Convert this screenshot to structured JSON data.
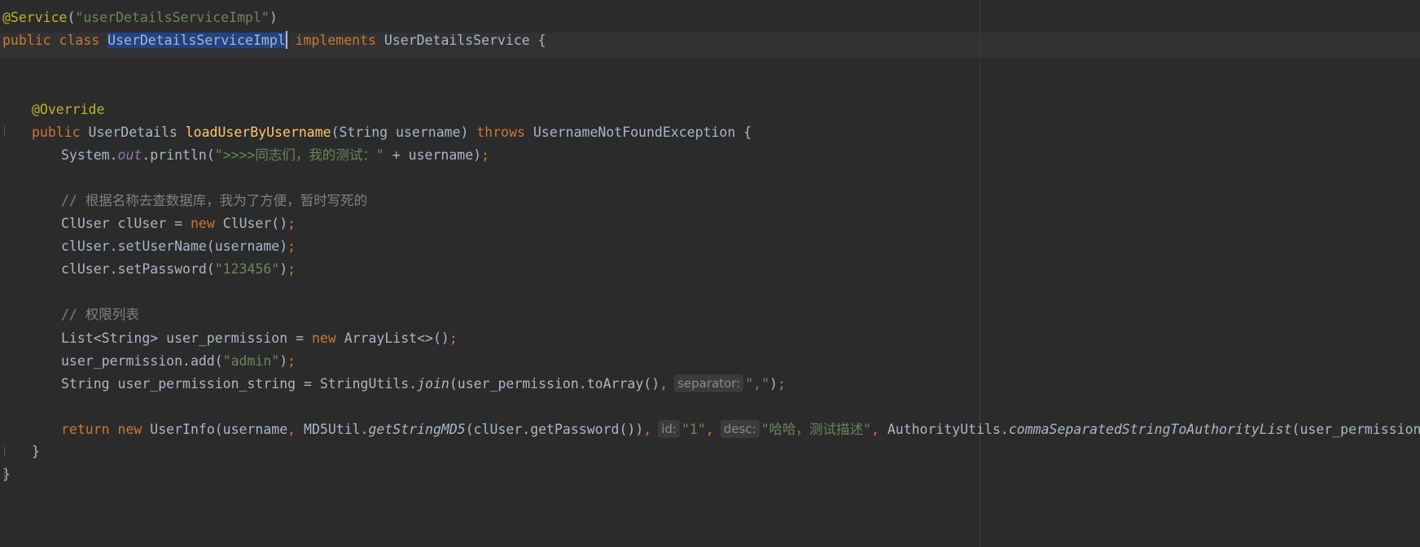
{
  "editor": {
    "lines": {
      "l1": {
        "t1": "@Service",
        "t2": "(",
        "t3": "\"userDetailsServiceImpl\"",
        "t4": ")"
      },
      "l2": {
        "t1": "public class ",
        "t2": "UserDetailsServiceImpl",
        "t3": " ",
        "t4": "implements",
        "t5": " UserDetailsService {"
      },
      "l5": {
        "t1": "@Override"
      },
      "l6": {
        "t1": "public",
        "t2": " UserDetails ",
        "t3": "loadUserByUsername",
        "t4": "(String username) ",
        "t5": "throws",
        "t6": " UsernameNotFoundException {"
      },
      "l7": {
        "t1": "System.",
        "t2": "out",
        "t3": ".println(",
        "t4": "\">>>>同志们，我的测试：\"",
        "t5": " + username)",
        "t6": ";"
      },
      "l9": {
        "t1": "// 根据名称去查数据库，我为了方便，暂时写死的"
      },
      "l10": {
        "t1": "ClUser clUser = ",
        "t2": "new",
        "t3": " ClUser()",
        "t4": ";"
      },
      "l11": {
        "t1": "clUser.setUserName(username)",
        "t2": ";"
      },
      "l12": {
        "t1": "clUser.setPassword(",
        "t2": "\"123456\"",
        "t3": ")",
        "t4": ";"
      },
      "l14": {
        "t1": "// 权限列表"
      },
      "l15": {
        "t1": "List<String> user_permission = ",
        "t2": "new",
        "t3": " ArrayList<>()",
        "t4": ";"
      },
      "l16": {
        "t1": "user_permission.add(",
        "t2": "\"admin\"",
        "t3": ")",
        "t4": ";"
      },
      "l17": {
        "t1": "String user_permission_string = StringUtils.",
        "t2": "join",
        "t3": "(user_permission.toArray()",
        "t4": ",",
        "h1": "separator:",
        "t5": "\",\"",
        "t6": ")",
        "t7": ";"
      },
      "l19": {
        "t1": "return new",
        "t2": " UserInfo(username",
        "t3": ",",
        "t4": " MD5Util.",
        "t5": "getStringMD5",
        "t6": "(clUser.getPassword())",
        "t7": ",",
        "h1": "id:",
        "t8": "\"1\"",
        "t9": ",",
        "h2": "desc:",
        "t10": "\"哈哈，测试描述\"",
        "t11": ",",
        "t12": " AuthorityUtils.",
        "t13": "commaSeparatedStringToAuthorityList",
        "t14": "(user_permission_string)",
        "t15": ");"
      },
      "l20": {
        "t1": "}"
      },
      "l21": {
        "t1": "}"
      }
    }
  }
}
